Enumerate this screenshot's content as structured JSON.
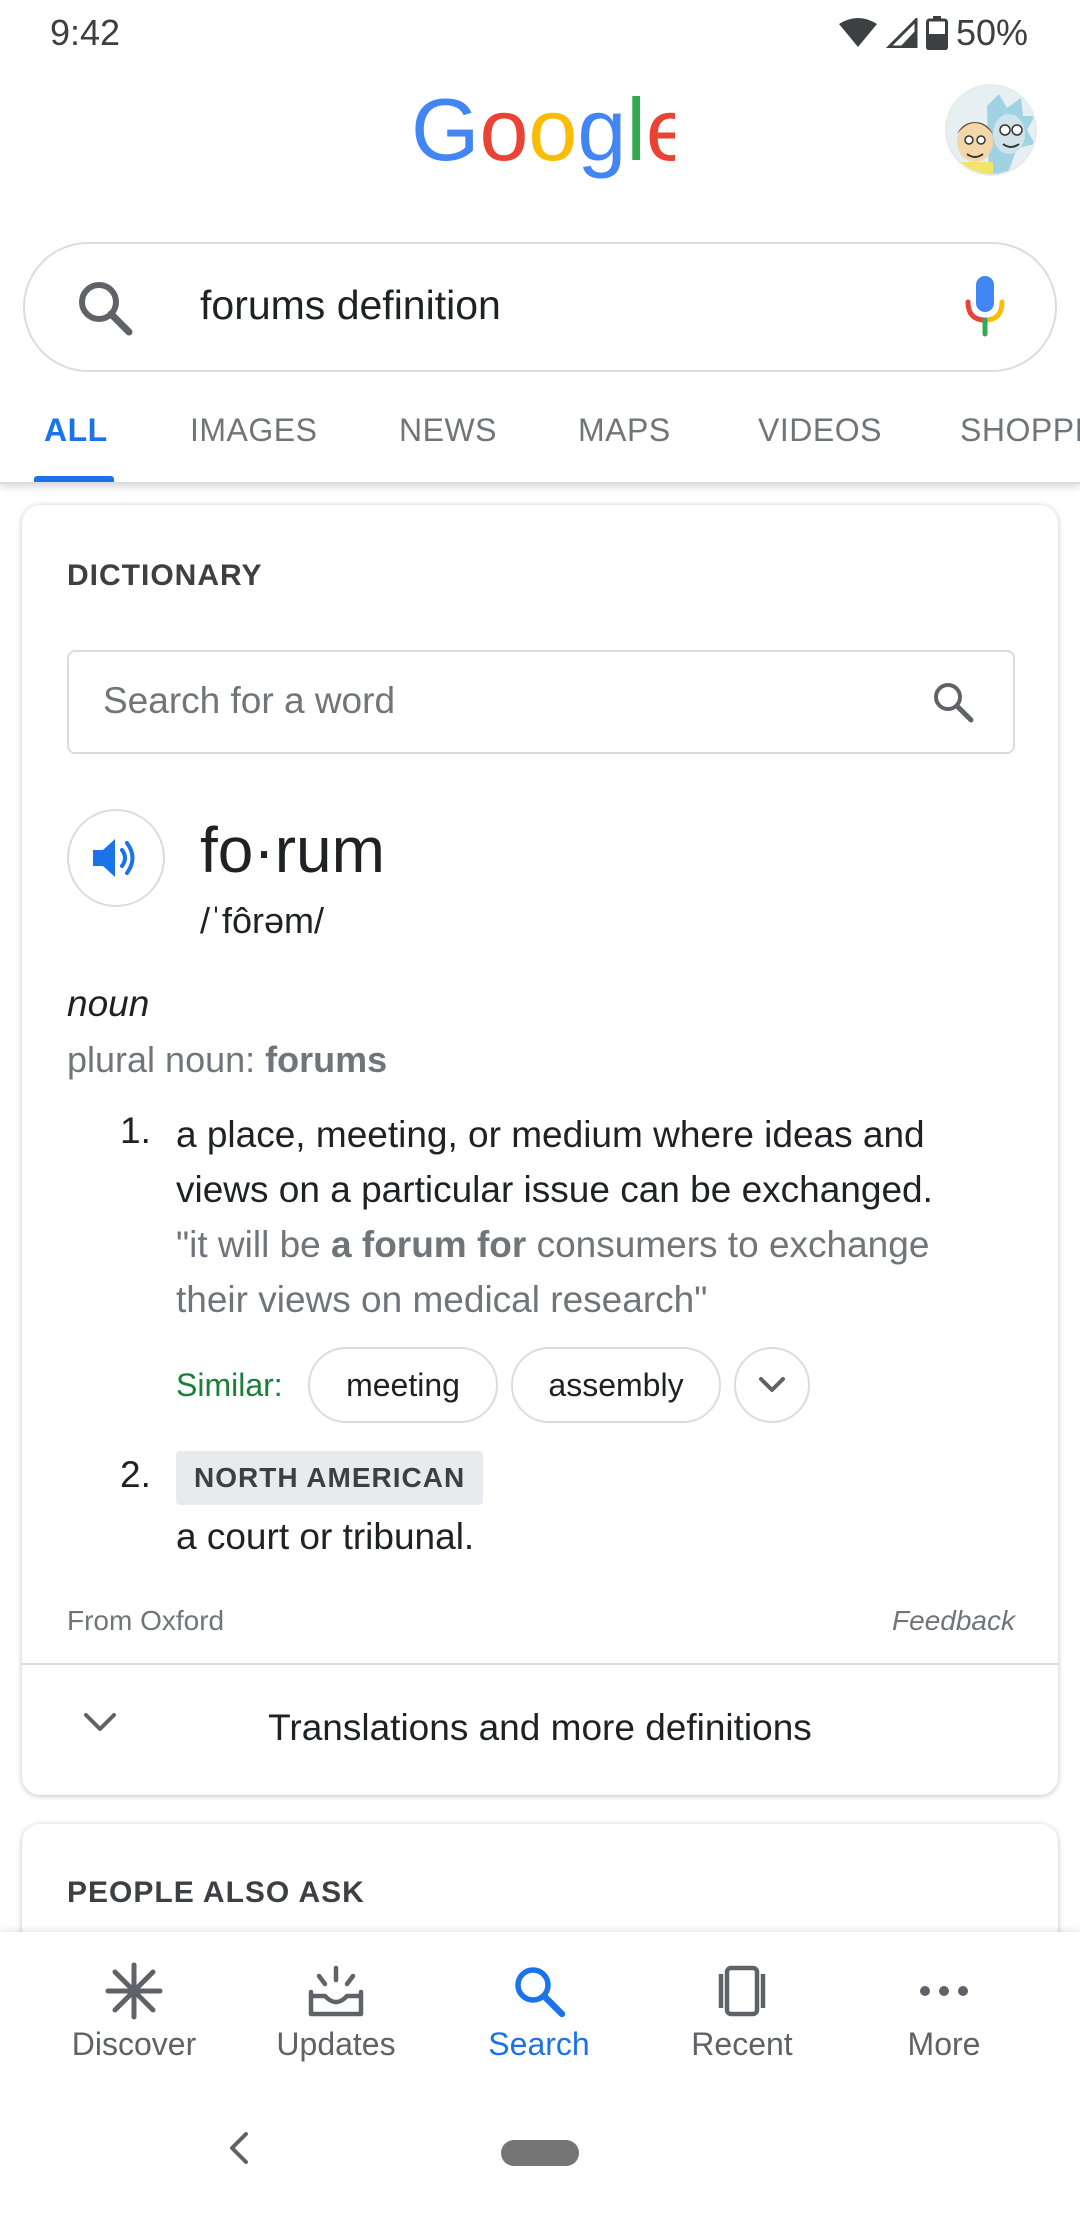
{
  "status_bar": {
    "time": "9:42",
    "battery": "50%"
  },
  "header": {
    "logo_text": "Google"
  },
  "search": {
    "query": "forums definition"
  },
  "tabs": [
    {
      "label": "ALL"
    },
    {
      "label": "IMAGES"
    },
    {
      "label": "NEWS"
    },
    {
      "label": "MAPS"
    },
    {
      "label": "VIDEOS"
    },
    {
      "label": "SHOPPI"
    }
  ],
  "dictionary": {
    "section_title": "DICTIONARY",
    "search_placeholder": "Search for a word",
    "word": "fo·rum",
    "phonetic": "/ˈfôrəm/",
    "part_of_speech": "noun",
    "plural_label": "plural noun: ",
    "plural_value": "forums",
    "definitions": [
      {
        "number": "1.",
        "text": "a place, meeting, or medium where ideas and views on a particular issue can be exchanged.",
        "example_prefix": "\"it will be ",
        "example_bold": "a forum for",
        "example_suffix": " consumers to exchange their views on medical research\"",
        "similar_label": "Similar:",
        "similar": [
          "meeting",
          "assembly"
        ]
      },
      {
        "number": "2.",
        "region": "NORTH AMERICAN",
        "text": "a court or tribunal."
      }
    ],
    "source": "From Oxford",
    "feedback": "Feedback",
    "more_label": "Translations and more definitions"
  },
  "people_also_ask": {
    "title": "PEOPLE ALSO ASK"
  },
  "bottom_nav": {
    "items": [
      {
        "label": "Discover",
        "icon": "asterisk-icon"
      },
      {
        "label": "Updates",
        "icon": "inbox-icon"
      },
      {
        "label": "Search",
        "icon": "search-icon",
        "active": true
      },
      {
        "label": "Recent",
        "icon": "recent-cards-icon"
      },
      {
        "label": "More",
        "icon": "more-dots-icon"
      }
    ]
  },
  "colors": {
    "accent": "#1a73e8",
    "similar_green": "#188038",
    "muted_text": "#70757a"
  }
}
